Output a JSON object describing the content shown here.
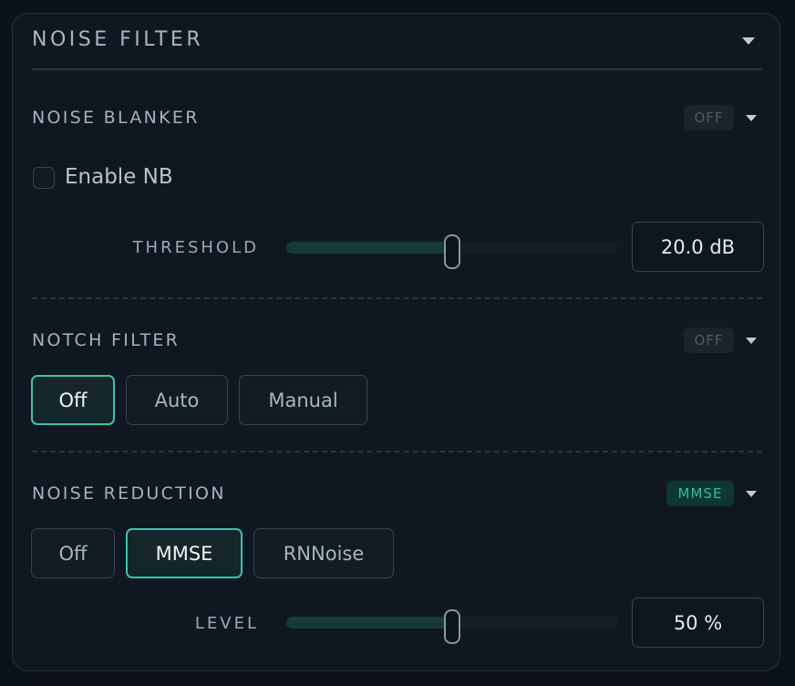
{
  "panel": {
    "title": "NOISE FILTER",
    "collapse_icon": "caret-down-icon"
  },
  "noise_blanker": {
    "title": "NOISE BLANKER",
    "status_badge": "OFF",
    "enable_checkbox": {
      "label": "Enable NB",
      "checked": false
    },
    "threshold": {
      "label": "THRESHOLD",
      "value_text": "20.0 dB",
      "level_fraction": 0.5
    }
  },
  "notch_filter": {
    "title": "NOTCH FILTER",
    "status_badge": "OFF",
    "modes": [
      "Off",
      "Auto",
      "Manual"
    ],
    "selected_mode": "Off"
  },
  "noise_reduction": {
    "title": "NOISE REDUCTION",
    "status_badge": "MMSE",
    "modes": [
      "Off",
      "MMSE",
      "RNNoise"
    ],
    "selected_mode": "MMSE",
    "level": {
      "label": "LEVEL",
      "value_text": "50 %",
      "level_fraction": 0.5
    }
  },
  "colors": {
    "accent": "#3ec1ad",
    "badge_active_text": "#2fbfa3",
    "badge_off_text": "#4f5c66",
    "panel_bg": "#0f1820"
  }
}
